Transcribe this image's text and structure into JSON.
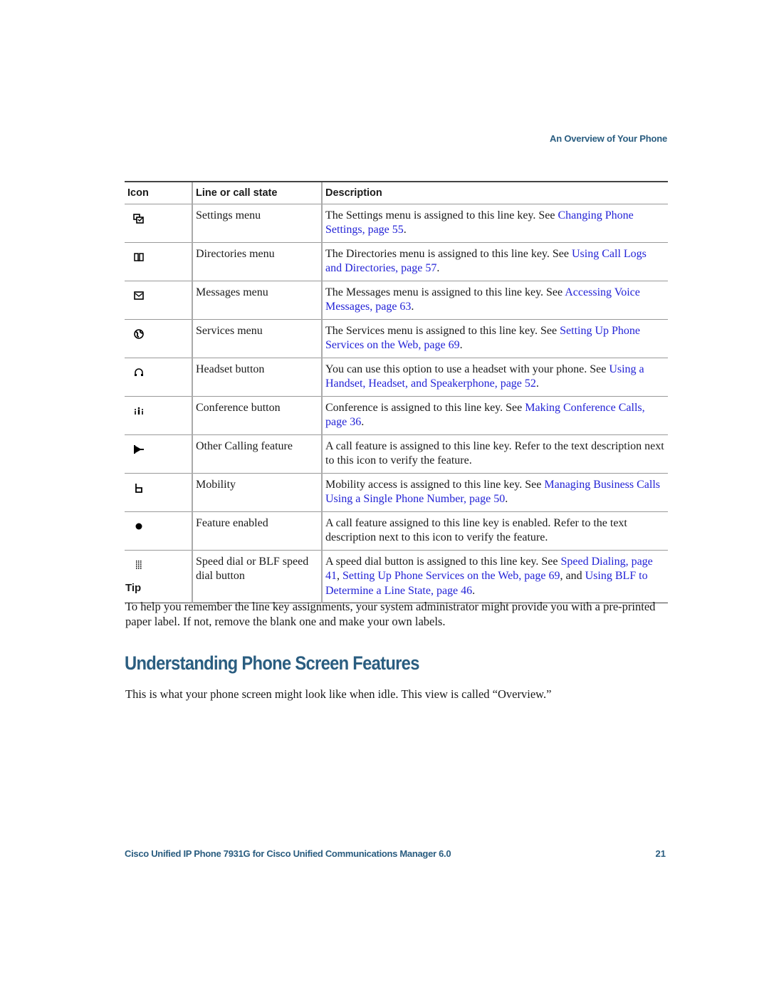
{
  "header": {
    "running_head": "An Overview of Your Phone"
  },
  "table": {
    "columns": [
      "Icon",
      "Line or call state",
      "Description"
    ],
    "rows": [
      {
        "icon": "settings-menu-icon",
        "state": "Settings menu",
        "desc_pre": "The Settings menu is assigned to this line key. See ",
        "link1": "Changing Phone Settings, page 55",
        "mid": "",
        "link2": "",
        "mid2": "",
        "link3": "",
        "post": "."
      },
      {
        "icon": "directories-book-icon",
        "state": "Directories menu",
        "desc_pre": "The Directories menu is assigned to this line key. See ",
        "link1": "Using Call Logs and Directories, page 57",
        "mid": "",
        "link2": "",
        "mid2": "",
        "link3": "",
        "post": "."
      },
      {
        "icon": "messages-envelope-icon",
        "state": "Messages menu",
        "desc_pre": "The Messages menu is assigned to this line key. See ",
        "link1": "Accessing Voice Messages, page 63",
        "mid": "",
        "link2": "",
        "mid2": "",
        "link3": "",
        "post": "."
      },
      {
        "icon": "services-globe-icon",
        "state": "Services menu",
        "desc_pre": "The Services menu is assigned to this line key. See ",
        "link1": "Setting Up Phone Services on the Web, page 69",
        "mid": "",
        "link2": "",
        "mid2": "",
        "link3": "",
        "post": "."
      },
      {
        "icon": "headset-icon",
        "state": "Headset button",
        "desc_pre": "You can use this option to use a headset with your phone. See ",
        "link1": "Using a Handset, Headset, and Speakerphone, page 52",
        "mid": "",
        "link2": "",
        "mid2": "",
        "link3": "",
        "post": "."
      },
      {
        "icon": "conference-icon",
        "state": "Conference button",
        "desc_pre": "Conference is assigned to this line key. See ",
        "link1": "Making Conference Calls, page 36",
        "mid": "",
        "link2": "",
        "mid2": "",
        "link3": "",
        "post": "."
      },
      {
        "icon": "call-feature-flag-icon",
        "state": "Other Calling feature",
        "desc_pre": "A call feature is assigned to this line key. Refer to the text description next to this icon to verify the feature.",
        "link1": "",
        "mid": "",
        "link2": "",
        "mid2": "",
        "link3": "",
        "post": ""
      },
      {
        "icon": "mobility-icon",
        "state": "Mobility",
        "desc_pre": "Mobility access is assigned to this line key. See ",
        "link1": "Managing Business Calls Using a Single Phone Number, page 50",
        "mid": "",
        "link2": "",
        "mid2": "",
        "link3": "",
        "post": "."
      },
      {
        "icon": "feature-enabled-dot-icon",
        "state": "Feature enabled",
        "desc_pre": "A call feature assigned to this line key is enabled. Refer to the text description next to this icon to verify the feature.",
        "link1": "",
        "mid": "",
        "link2": "",
        "mid2": "",
        "link3": "",
        "post": ""
      },
      {
        "icon": "speed-dial-grid-icon",
        "state": "Speed dial or BLF speed dial button",
        "desc_pre": "A speed dial button is assigned to this line key. See ",
        "link1": "Speed Dialing, page 41",
        "mid": ", ",
        "link2": "Setting Up Phone Services on the Web, page 69",
        "mid2": ", and ",
        "link3": "Using BLF to Determine a Line State, page 46",
        "post": "."
      }
    ]
  },
  "tip": {
    "label": "Tip",
    "text": "To help you remember the line key assignments, your system administrator might provide you with a pre-printed paper label. If not, remove the blank one and make your own labels."
  },
  "section": {
    "title": "Understanding Phone Screen Features",
    "intro": "This is what your phone screen might look like when idle. This view is called “Overview.”"
  },
  "footer": {
    "title": "Cisco Unified IP Phone 7931G for Cisco Unified Communications Manager 6.0",
    "page_number": "21"
  },
  "colors": {
    "heading": "#2a5d80",
    "link": "#2323d6"
  }
}
